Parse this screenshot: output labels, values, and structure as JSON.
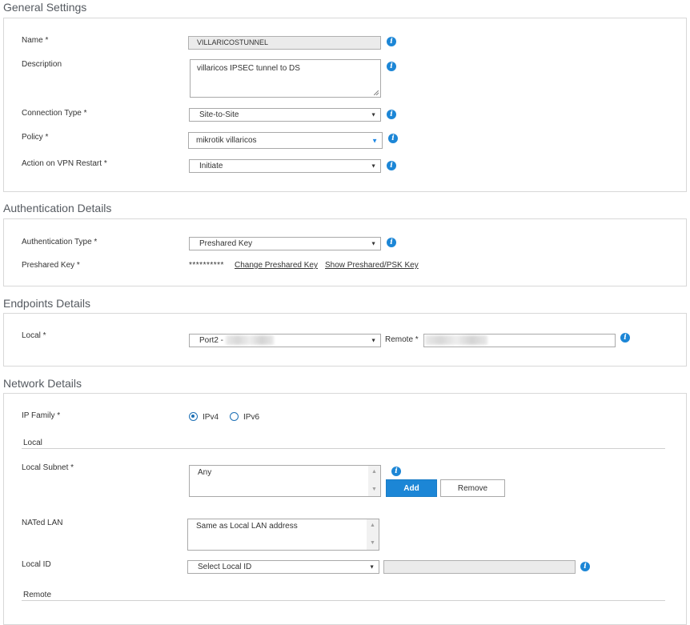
{
  "sections": {
    "general": "General Settings",
    "auth": "Authentication Details",
    "endpoints": "Endpoints Details",
    "network": "Network Details"
  },
  "general": {
    "name_label": "Name *",
    "name_value": "VILLARICOSTUNNEL",
    "description_label": "Description",
    "description_value": "villaricos IPSEC tunnel to DS",
    "connection_type_label": "Connection Type *",
    "connection_type_value": "Site-to-Site",
    "policy_label": "Policy *",
    "policy_value": "mikrotik villaricos",
    "action_label": "Action on VPN Restart *",
    "action_value": "Initiate"
  },
  "auth": {
    "type_label": "Authentication Type *",
    "type_value": "Preshared Key",
    "psk_label": "Preshared Key *",
    "psk_mask": "**********",
    "change_link": "Change Preshared Key",
    "show_link": "Show Preshared/PSK Key"
  },
  "endpoints": {
    "local_label": "Local *",
    "local_value": "Port2 -",
    "remote_label": "Remote *"
  },
  "network": {
    "ip_family_label": "IP Family *",
    "ipv4_label": "IPv4",
    "ipv6_label": "IPv6",
    "ip_family_selected": "IPv4",
    "local_heading": "Local",
    "local_subnet_label": "Local Subnet *",
    "local_subnet_value": "Any",
    "add_button": "Add",
    "remove_button": "Remove",
    "nated_lan_label": "NATed LAN",
    "nated_lan_value": "Same as Local LAN address",
    "local_id_label": "Local ID",
    "local_id_value": "Select Local ID",
    "remote_heading": "Remote"
  },
  "icons": {
    "info": "info-icon",
    "caret": "chevron-down-icon"
  },
  "colors": {
    "accent": "#1c86d6",
    "border": "#d8d8d8"
  }
}
